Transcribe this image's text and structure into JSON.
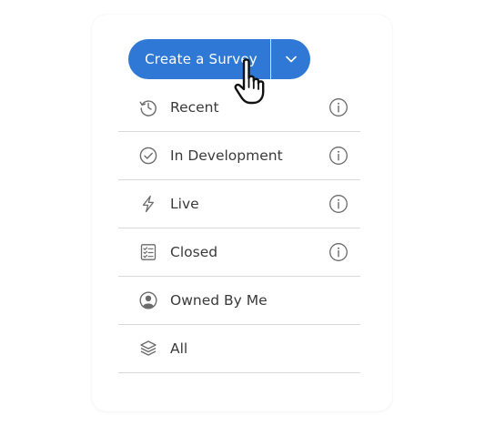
{
  "colors": {
    "accent": "#2f78d6",
    "text": "#3a3a3a",
    "icon": "#6b6b6b",
    "divider": "#d9d9d9"
  },
  "create_button": {
    "label": "Create a Survey",
    "toggle_icon": "chevron-down-icon"
  },
  "menu": {
    "items": [
      {
        "label": "Recent",
        "icon": "history-icon",
        "has_info": true
      },
      {
        "label": "In Development",
        "icon": "check-circle-icon",
        "has_info": true
      },
      {
        "label": "Live",
        "icon": "lightning-icon",
        "has_info": true
      },
      {
        "label": "Closed",
        "icon": "checklist-icon",
        "has_info": true
      },
      {
        "label": "Owned By Me",
        "icon": "user-circle-icon",
        "has_info": false
      },
      {
        "label": "All",
        "icon": "layers-icon",
        "has_info": false
      }
    ]
  },
  "cursor": {
    "icon": "pointer-hand-icon"
  }
}
